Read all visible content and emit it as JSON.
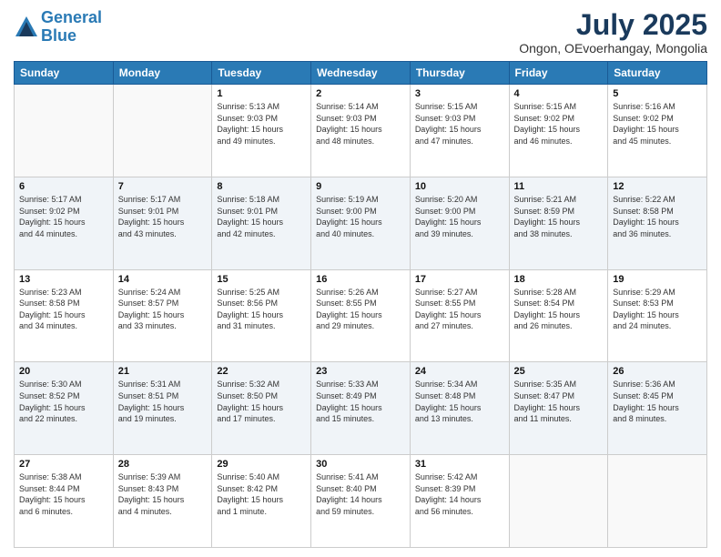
{
  "header": {
    "logo_line1": "General",
    "logo_line2": "Blue",
    "month_year": "July 2025",
    "location": "Ongon, OEvoerhangay, Mongolia"
  },
  "days_of_week": [
    "Sunday",
    "Monday",
    "Tuesday",
    "Wednesday",
    "Thursday",
    "Friday",
    "Saturday"
  ],
  "weeks": [
    [
      {
        "day": "",
        "content": ""
      },
      {
        "day": "",
        "content": ""
      },
      {
        "day": "1",
        "content": "Sunrise: 5:13 AM\nSunset: 9:03 PM\nDaylight: 15 hours\nand 49 minutes."
      },
      {
        "day": "2",
        "content": "Sunrise: 5:14 AM\nSunset: 9:03 PM\nDaylight: 15 hours\nand 48 minutes."
      },
      {
        "day": "3",
        "content": "Sunrise: 5:15 AM\nSunset: 9:03 PM\nDaylight: 15 hours\nand 47 minutes."
      },
      {
        "day": "4",
        "content": "Sunrise: 5:15 AM\nSunset: 9:02 PM\nDaylight: 15 hours\nand 46 minutes."
      },
      {
        "day": "5",
        "content": "Sunrise: 5:16 AM\nSunset: 9:02 PM\nDaylight: 15 hours\nand 45 minutes."
      }
    ],
    [
      {
        "day": "6",
        "content": "Sunrise: 5:17 AM\nSunset: 9:02 PM\nDaylight: 15 hours\nand 44 minutes."
      },
      {
        "day": "7",
        "content": "Sunrise: 5:17 AM\nSunset: 9:01 PM\nDaylight: 15 hours\nand 43 minutes."
      },
      {
        "day": "8",
        "content": "Sunrise: 5:18 AM\nSunset: 9:01 PM\nDaylight: 15 hours\nand 42 minutes."
      },
      {
        "day": "9",
        "content": "Sunrise: 5:19 AM\nSunset: 9:00 PM\nDaylight: 15 hours\nand 40 minutes."
      },
      {
        "day": "10",
        "content": "Sunrise: 5:20 AM\nSunset: 9:00 PM\nDaylight: 15 hours\nand 39 minutes."
      },
      {
        "day": "11",
        "content": "Sunrise: 5:21 AM\nSunset: 8:59 PM\nDaylight: 15 hours\nand 38 minutes."
      },
      {
        "day": "12",
        "content": "Sunrise: 5:22 AM\nSunset: 8:58 PM\nDaylight: 15 hours\nand 36 minutes."
      }
    ],
    [
      {
        "day": "13",
        "content": "Sunrise: 5:23 AM\nSunset: 8:58 PM\nDaylight: 15 hours\nand 34 minutes."
      },
      {
        "day": "14",
        "content": "Sunrise: 5:24 AM\nSunset: 8:57 PM\nDaylight: 15 hours\nand 33 minutes."
      },
      {
        "day": "15",
        "content": "Sunrise: 5:25 AM\nSunset: 8:56 PM\nDaylight: 15 hours\nand 31 minutes."
      },
      {
        "day": "16",
        "content": "Sunrise: 5:26 AM\nSunset: 8:55 PM\nDaylight: 15 hours\nand 29 minutes."
      },
      {
        "day": "17",
        "content": "Sunrise: 5:27 AM\nSunset: 8:55 PM\nDaylight: 15 hours\nand 27 minutes."
      },
      {
        "day": "18",
        "content": "Sunrise: 5:28 AM\nSunset: 8:54 PM\nDaylight: 15 hours\nand 26 minutes."
      },
      {
        "day": "19",
        "content": "Sunrise: 5:29 AM\nSunset: 8:53 PM\nDaylight: 15 hours\nand 24 minutes."
      }
    ],
    [
      {
        "day": "20",
        "content": "Sunrise: 5:30 AM\nSunset: 8:52 PM\nDaylight: 15 hours\nand 22 minutes."
      },
      {
        "day": "21",
        "content": "Sunrise: 5:31 AM\nSunset: 8:51 PM\nDaylight: 15 hours\nand 19 minutes."
      },
      {
        "day": "22",
        "content": "Sunrise: 5:32 AM\nSunset: 8:50 PM\nDaylight: 15 hours\nand 17 minutes."
      },
      {
        "day": "23",
        "content": "Sunrise: 5:33 AM\nSunset: 8:49 PM\nDaylight: 15 hours\nand 15 minutes."
      },
      {
        "day": "24",
        "content": "Sunrise: 5:34 AM\nSunset: 8:48 PM\nDaylight: 15 hours\nand 13 minutes."
      },
      {
        "day": "25",
        "content": "Sunrise: 5:35 AM\nSunset: 8:47 PM\nDaylight: 15 hours\nand 11 minutes."
      },
      {
        "day": "26",
        "content": "Sunrise: 5:36 AM\nSunset: 8:45 PM\nDaylight: 15 hours\nand 8 minutes."
      }
    ],
    [
      {
        "day": "27",
        "content": "Sunrise: 5:38 AM\nSunset: 8:44 PM\nDaylight: 15 hours\nand 6 minutes."
      },
      {
        "day": "28",
        "content": "Sunrise: 5:39 AM\nSunset: 8:43 PM\nDaylight: 15 hours\nand 4 minutes."
      },
      {
        "day": "29",
        "content": "Sunrise: 5:40 AM\nSunset: 8:42 PM\nDaylight: 15 hours\nand 1 minute."
      },
      {
        "day": "30",
        "content": "Sunrise: 5:41 AM\nSunset: 8:40 PM\nDaylight: 14 hours\nand 59 minutes."
      },
      {
        "day": "31",
        "content": "Sunrise: 5:42 AM\nSunset: 8:39 PM\nDaylight: 14 hours\nand 56 minutes."
      },
      {
        "day": "",
        "content": ""
      },
      {
        "day": "",
        "content": ""
      }
    ]
  ]
}
